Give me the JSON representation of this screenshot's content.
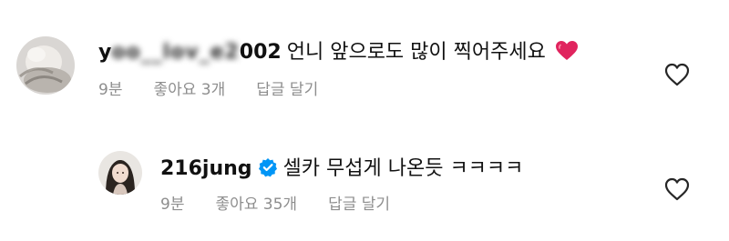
{
  "comments": [
    {
      "username_partial": "y",
      "username_masked": "oo__lov_e2",
      "username_tail": "002",
      "text": "언니 앞으로도 많이 찍어주세요",
      "emoji": "heart-emoji",
      "time": "9분",
      "likes": "좋아요 3개",
      "reply": "답글 달기",
      "like_icon": "heart-outline-icon"
    },
    {
      "username": "216jung",
      "verified_icon": "verified-badge-icon",
      "text": "셀카 무섭게 나온듯 ㅋㅋㅋㅋ",
      "time": "9분",
      "likes": "좋아요 35개",
      "reply": "답글 달기",
      "like_icon": "heart-outline-icon"
    }
  ],
  "colors": {
    "text": "#111111",
    "meta": "#8e8e8e",
    "verified": "#0095f6",
    "heart": "#e0245e"
  }
}
